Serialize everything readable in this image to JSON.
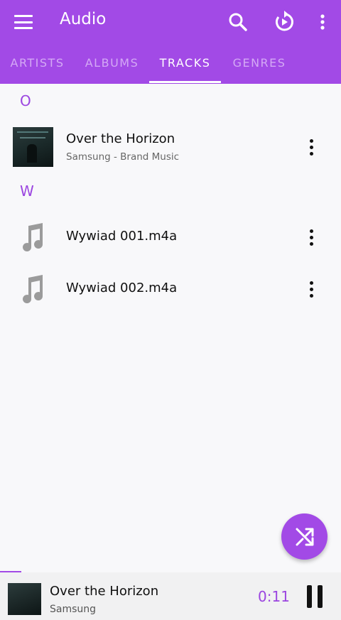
{
  "appbar": {
    "title": "Audio",
    "accent": "#a24ae6"
  },
  "actions": [
    "search-icon",
    "history-icon",
    "more-vert-icon"
  ],
  "tabs": [
    {
      "label": "ARTISTS",
      "active": false
    },
    {
      "label": "ALBUMS",
      "active": false
    },
    {
      "label": "TRACKS",
      "active": true
    },
    {
      "label": "GENRES",
      "active": false
    }
  ],
  "sections": [
    {
      "letter": "O"
    },
    {
      "letter": "W"
    }
  ],
  "tracks": [
    {
      "title": "Over the Horizon",
      "subtitle": "Samsung - Brand Music",
      "art": "album-art"
    },
    {
      "title": "Wywiad 001.m4a",
      "subtitle": "",
      "art": "music-note-icon"
    },
    {
      "title": "Wywiad 002.m4a",
      "subtitle": "",
      "art": "music-note-icon"
    }
  ],
  "fab": {
    "icon": "shuffle-icon"
  },
  "now_playing": {
    "title": "Over the Horizon",
    "artist": "Samsung",
    "time": "0:11",
    "state": "playing",
    "progress_pct": 6
  }
}
